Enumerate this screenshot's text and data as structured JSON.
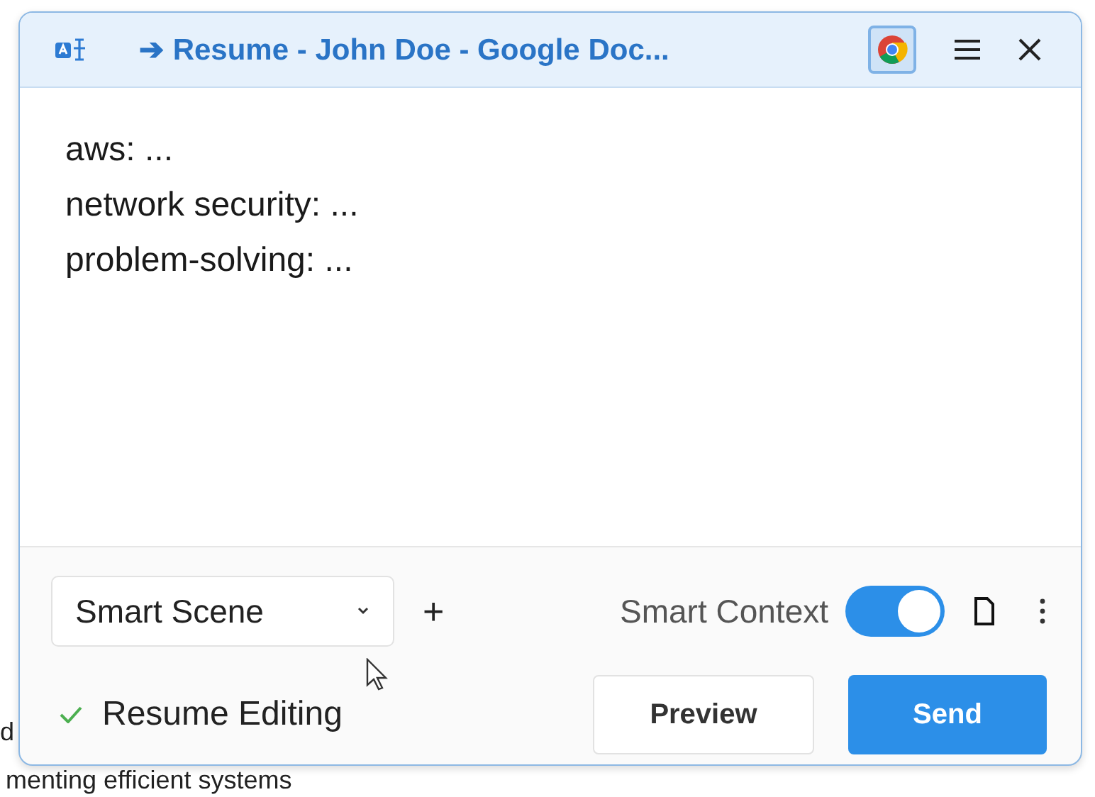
{
  "background_document": {
    "lines": [
      "d",
      "menting efficient systems"
    ]
  },
  "window": {
    "title": "➔ Resume - John Doe - Google Doc...",
    "browser_pinned": true
  },
  "content": {
    "lines": [
      "aws: ...",
      "network security: ...",
      "problem-solving: ..."
    ]
  },
  "footer": {
    "scene_select": {
      "value": "Smart Scene"
    },
    "add_button": "+",
    "smart_context": {
      "label": "Smart Context",
      "on": true
    },
    "status": {
      "text": "Resume Editing",
      "done": true
    },
    "buttons": [
      {
        "label": "Preview",
        "kind": "secondary"
      },
      {
        "label": "Send",
        "kind": "primary"
      }
    ]
  }
}
